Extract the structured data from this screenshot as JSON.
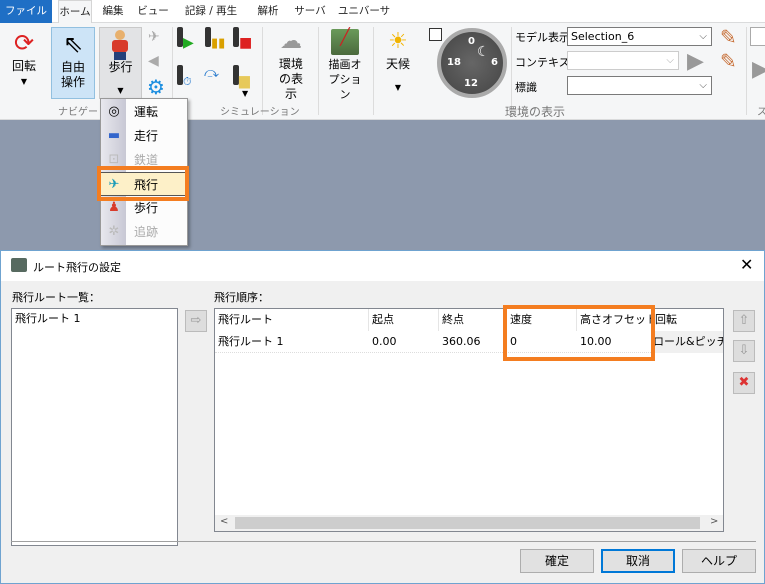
{
  "tabs": [
    "ファイル",
    "ホーム",
    "編集",
    "ビュー",
    "記録 / 再生",
    "解析",
    "サーバ",
    "ユニバーサルUI"
  ],
  "ribbon": {
    "rotate": "回転",
    "free": "自由操作",
    "walk": "歩行",
    "env_show": "環境の表示",
    "draw_opt": "描画オプション",
    "weather": "天候",
    "groups": {
      "nav": "ナビゲー",
      "sim": "シミュレーション",
      "env": "環境の表示",
      "s": "ス"
    },
    "clock": {
      "n0": "0",
      "n6": "6",
      "n12": "12",
      "n18": "18"
    },
    "model_label": "モデル表示",
    "model_value": "Selection_6",
    "context_label": "コンテキスト",
    "context_value": "",
    "sign_label": "標識",
    "sign_value": ""
  },
  "menu": {
    "items": [
      {
        "label": "運転",
        "icon": "steering-wheel-icon",
        "enabled": true
      },
      {
        "label": "走行",
        "icon": "car-icon",
        "enabled": true
      },
      {
        "label": "鉄道",
        "icon": "train-icon",
        "enabled": false
      },
      {
        "label": "飛行",
        "icon": "airplane-icon",
        "enabled": true,
        "highlighted": true
      },
      {
        "label": "歩行",
        "icon": "walker-icon",
        "enabled": true
      },
      {
        "label": "追跡",
        "icon": "track-icon",
        "enabled": false
      }
    ]
  },
  "dialog": {
    "title": "ルート飛行の設定",
    "list_label": "飛行ルート一覧：",
    "list_items": [
      "飛行ルート 1"
    ],
    "order_label": "飛行順序：",
    "columns": [
      "飛行ルート",
      "起点",
      "終点",
      "速度",
      "高さオフセット",
      "回転"
    ],
    "rows": [
      [
        "飛行ルート 1",
        "0.00",
        "360.06",
        "0",
        "10.00",
        "ロール&ピッチ"
      ]
    ],
    "ok": "確定",
    "cancel": "取消",
    "help": "ヘルプ"
  },
  "colors": {
    "accent": "#1f6fc5",
    "highlight": "#f47d20"
  }
}
